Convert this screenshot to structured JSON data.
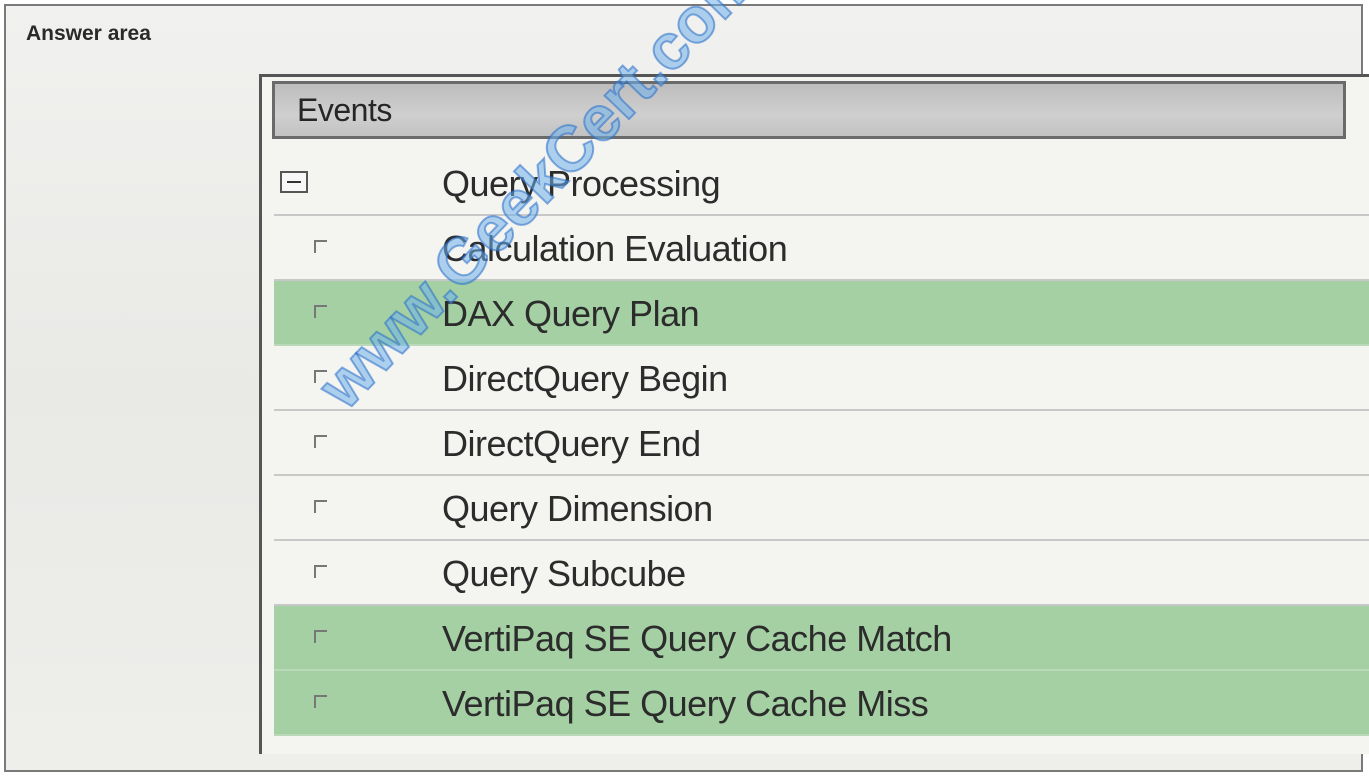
{
  "answer_area": {
    "label": "Answer area"
  },
  "events": {
    "header": "Events",
    "group": {
      "label": "Query Processing",
      "expander": "minus-icon"
    },
    "items": [
      {
        "label": "Calculation Evaluation",
        "selected": false
      },
      {
        "label": "DAX Query Plan",
        "selected": true
      },
      {
        "label": "DirectQuery Begin",
        "selected": false
      },
      {
        "label": "DirectQuery End",
        "selected": false
      },
      {
        "label": "Query Dimension",
        "selected": false
      },
      {
        "label": "Query Subcube",
        "selected": false
      },
      {
        "label": "VertiPaq SE Query Cache Match",
        "selected": true
      },
      {
        "label": "VertiPaq SE Query Cache Miss",
        "selected": true
      }
    ]
  },
  "watermark": {
    "text": "www.GeekCert.com"
  },
  "colors": {
    "selected_row": "#a4d0a4",
    "watermark": "#6fb0ea"
  }
}
